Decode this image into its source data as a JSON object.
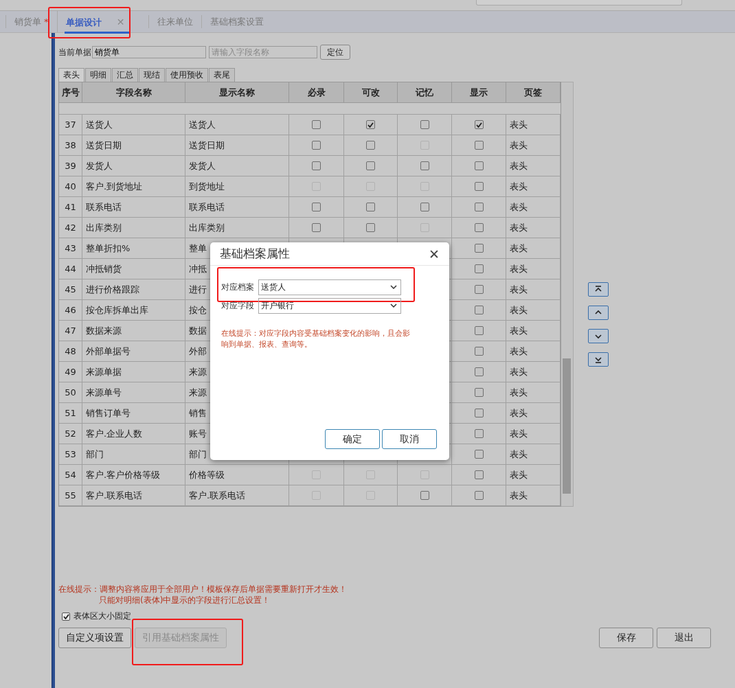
{
  "top_tabs": [
    {
      "label": "销货单",
      "marker": "*",
      "selected": false
    },
    {
      "label": "单据设计",
      "selected": true,
      "close": "✕",
      "highlighted": true
    },
    {
      "label": "往来单位",
      "selected": false
    },
    {
      "label": "基础档案设置",
      "selected": false
    }
  ],
  "current_doc": {
    "label": "当前单据",
    "value": "销货单",
    "search_placeholder": "请输入字段名称",
    "locate_button": "定位"
  },
  "sub_tabs": [
    {
      "label": "表头",
      "selected": true
    },
    {
      "label": "明细",
      "selected": false
    },
    {
      "label": "汇总",
      "selected": false
    },
    {
      "label": "现结",
      "selected": false
    },
    {
      "label": "使用预收",
      "selected": false
    },
    {
      "label": "表尾",
      "selected": false
    }
  ],
  "table": {
    "columns": [
      "序号",
      "字段名称",
      "显示名称",
      "必录",
      "可改",
      "记忆",
      "显示",
      "页签"
    ],
    "rows": [
      {
        "no": "37",
        "field": "送货人",
        "display": "送货人",
        "required": {
          "checked": false,
          "disabled": false
        },
        "editable": {
          "checked": true,
          "disabled": false
        },
        "remember": {
          "checked": false,
          "disabled": false
        },
        "show": {
          "checked": true,
          "disabled": false
        },
        "tab": "表头"
      },
      {
        "no": "38",
        "field": "送货日期",
        "display": "送货日期",
        "required": {
          "checked": false,
          "disabled": false
        },
        "editable": {
          "checked": false,
          "disabled": false
        },
        "remember": {
          "checked": false,
          "disabled": true
        },
        "show": {
          "checked": false,
          "disabled": false
        },
        "tab": "表头"
      },
      {
        "no": "39",
        "field": "发货人",
        "display": "发货人",
        "required": {
          "checked": false,
          "disabled": false
        },
        "editable": {
          "checked": false,
          "disabled": false
        },
        "remember": {
          "checked": false,
          "disabled": false
        },
        "show": {
          "checked": false,
          "disabled": false
        },
        "tab": "表头"
      },
      {
        "no": "40",
        "field": "客户.到货地址",
        "display": "到货地址",
        "required": {
          "checked": false,
          "disabled": true
        },
        "editable": {
          "checked": false,
          "disabled": true
        },
        "remember": {
          "checked": false,
          "disabled": true
        },
        "show": {
          "checked": false,
          "disabled": false
        },
        "tab": "表头"
      },
      {
        "no": "41",
        "field": "联系电话",
        "display": "联系电话",
        "required": {
          "checked": false,
          "disabled": false
        },
        "editable": {
          "checked": false,
          "disabled": false
        },
        "remember": {
          "checked": false,
          "disabled": false
        },
        "show": {
          "checked": false,
          "disabled": false
        },
        "tab": "表头"
      },
      {
        "no": "42",
        "field": "出库类别",
        "display": "出库类别",
        "required": {
          "checked": false,
          "disabled": false
        },
        "editable": {
          "checked": false,
          "disabled": false
        },
        "remember": {
          "checked": false,
          "disabled": true
        },
        "show": {
          "checked": false,
          "disabled": false
        },
        "tab": "表头"
      },
      {
        "no": "43",
        "field": "整单折扣%",
        "display": "整单",
        "show": {
          "checked": false,
          "disabled": false
        },
        "tab": "表头"
      },
      {
        "no": "44",
        "field": "冲抵销货",
        "display": "冲抵",
        "show": {
          "checked": false,
          "disabled": false
        },
        "tab": "表头"
      },
      {
        "no": "45",
        "field": "进行价格跟踪",
        "display": "进行",
        "show": {
          "checked": false,
          "disabled": false
        },
        "tab": "表头"
      },
      {
        "no": "46",
        "field": "按仓库拆单出库",
        "display": "按仓",
        "show": {
          "checked": false,
          "disabled": false
        },
        "tab": "表头"
      },
      {
        "no": "47",
        "field": "数据来源",
        "display": "数据",
        "show": {
          "checked": false,
          "disabled": false
        },
        "tab": "表头"
      },
      {
        "no": "48",
        "field": "外部单据号",
        "display": "外部",
        "show": {
          "checked": false,
          "disabled": false
        },
        "tab": "表头"
      },
      {
        "no": "49",
        "field": "来源单据",
        "display": "来源",
        "show": {
          "checked": false,
          "disabled": false
        },
        "tab": "表头"
      },
      {
        "no": "50",
        "field": "来源单号",
        "display": "来源",
        "show": {
          "checked": false,
          "disabled": false
        },
        "tab": "表头"
      },
      {
        "no": "51",
        "field": "销售订单号",
        "display": "销售",
        "show": {
          "checked": false,
          "disabled": false
        },
        "tab": "表头"
      },
      {
        "no": "52",
        "field": "客户.企业人数",
        "display": "账号",
        "show": {
          "checked": false,
          "disabled": false
        },
        "tab": "表头"
      },
      {
        "no": "53",
        "field": "部门",
        "display": "部门",
        "show": {
          "checked": false,
          "disabled": false
        },
        "tab": "表头"
      },
      {
        "no": "54",
        "field": "客户.客户价格等级",
        "display": "价格等级",
        "required": {
          "checked": false,
          "disabled": true
        },
        "editable": {
          "checked": false,
          "disabled": true
        },
        "remember": {
          "checked": false,
          "disabled": true
        },
        "show": {
          "checked": false,
          "disabled": false
        },
        "tab": "表头"
      },
      {
        "no": "55",
        "field": "客户.联系电话",
        "display": "客户.联系电话",
        "required": {
          "checked": false,
          "disabled": true
        },
        "editable": {
          "checked": false,
          "disabled": true
        },
        "remember": {
          "checked": false,
          "disabled": false
        },
        "show": {
          "checked": false,
          "disabled": false
        },
        "tab": "表头"
      }
    ]
  },
  "move_buttons": [
    {
      "kind": "top"
    },
    {
      "kind": "up"
    },
    {
      "kind": "down"
    },
    {
      "kind": "bottom"
    }
  ],
  "dialog": {
    "title": "基础档案属性",
    "close": "✕",
    "fields": [
      {
        "label": "对应档案",
        "value": "送货人",
        "highlighted": true
      },
      {
        "label": "对应字段",
        "value": "开户银行",
        "highlighted": false
      }
    ],
    "hint": "在线提示：对应字段内容受基础档案变化的影响，且会影响到单据、报表、查询等。",
    "buttons": [
      "确定",
      "取消"
    ]
  },
  "hints": [
    "在线提示：调整内容将应用于全部用户！模板保存后单据需要重新打开才生效！",
    "只能对明细(表体)中显示的字段进行汇总设置！"
  ],
  "fixed_size": {
    "label": "表体区大小固定",
    "checked": true
  },
  "left_buttons": [
    {
      "label": "自定义项设置",
      "disabled": false,
      "highlighted": false
    },
    {
      "label": "引用基础档案属性",
      "disabled": true,
      "highlighted": true
    }
  ],
  "right_buttons": [
    "保存",
    "退出"
  ]
}
